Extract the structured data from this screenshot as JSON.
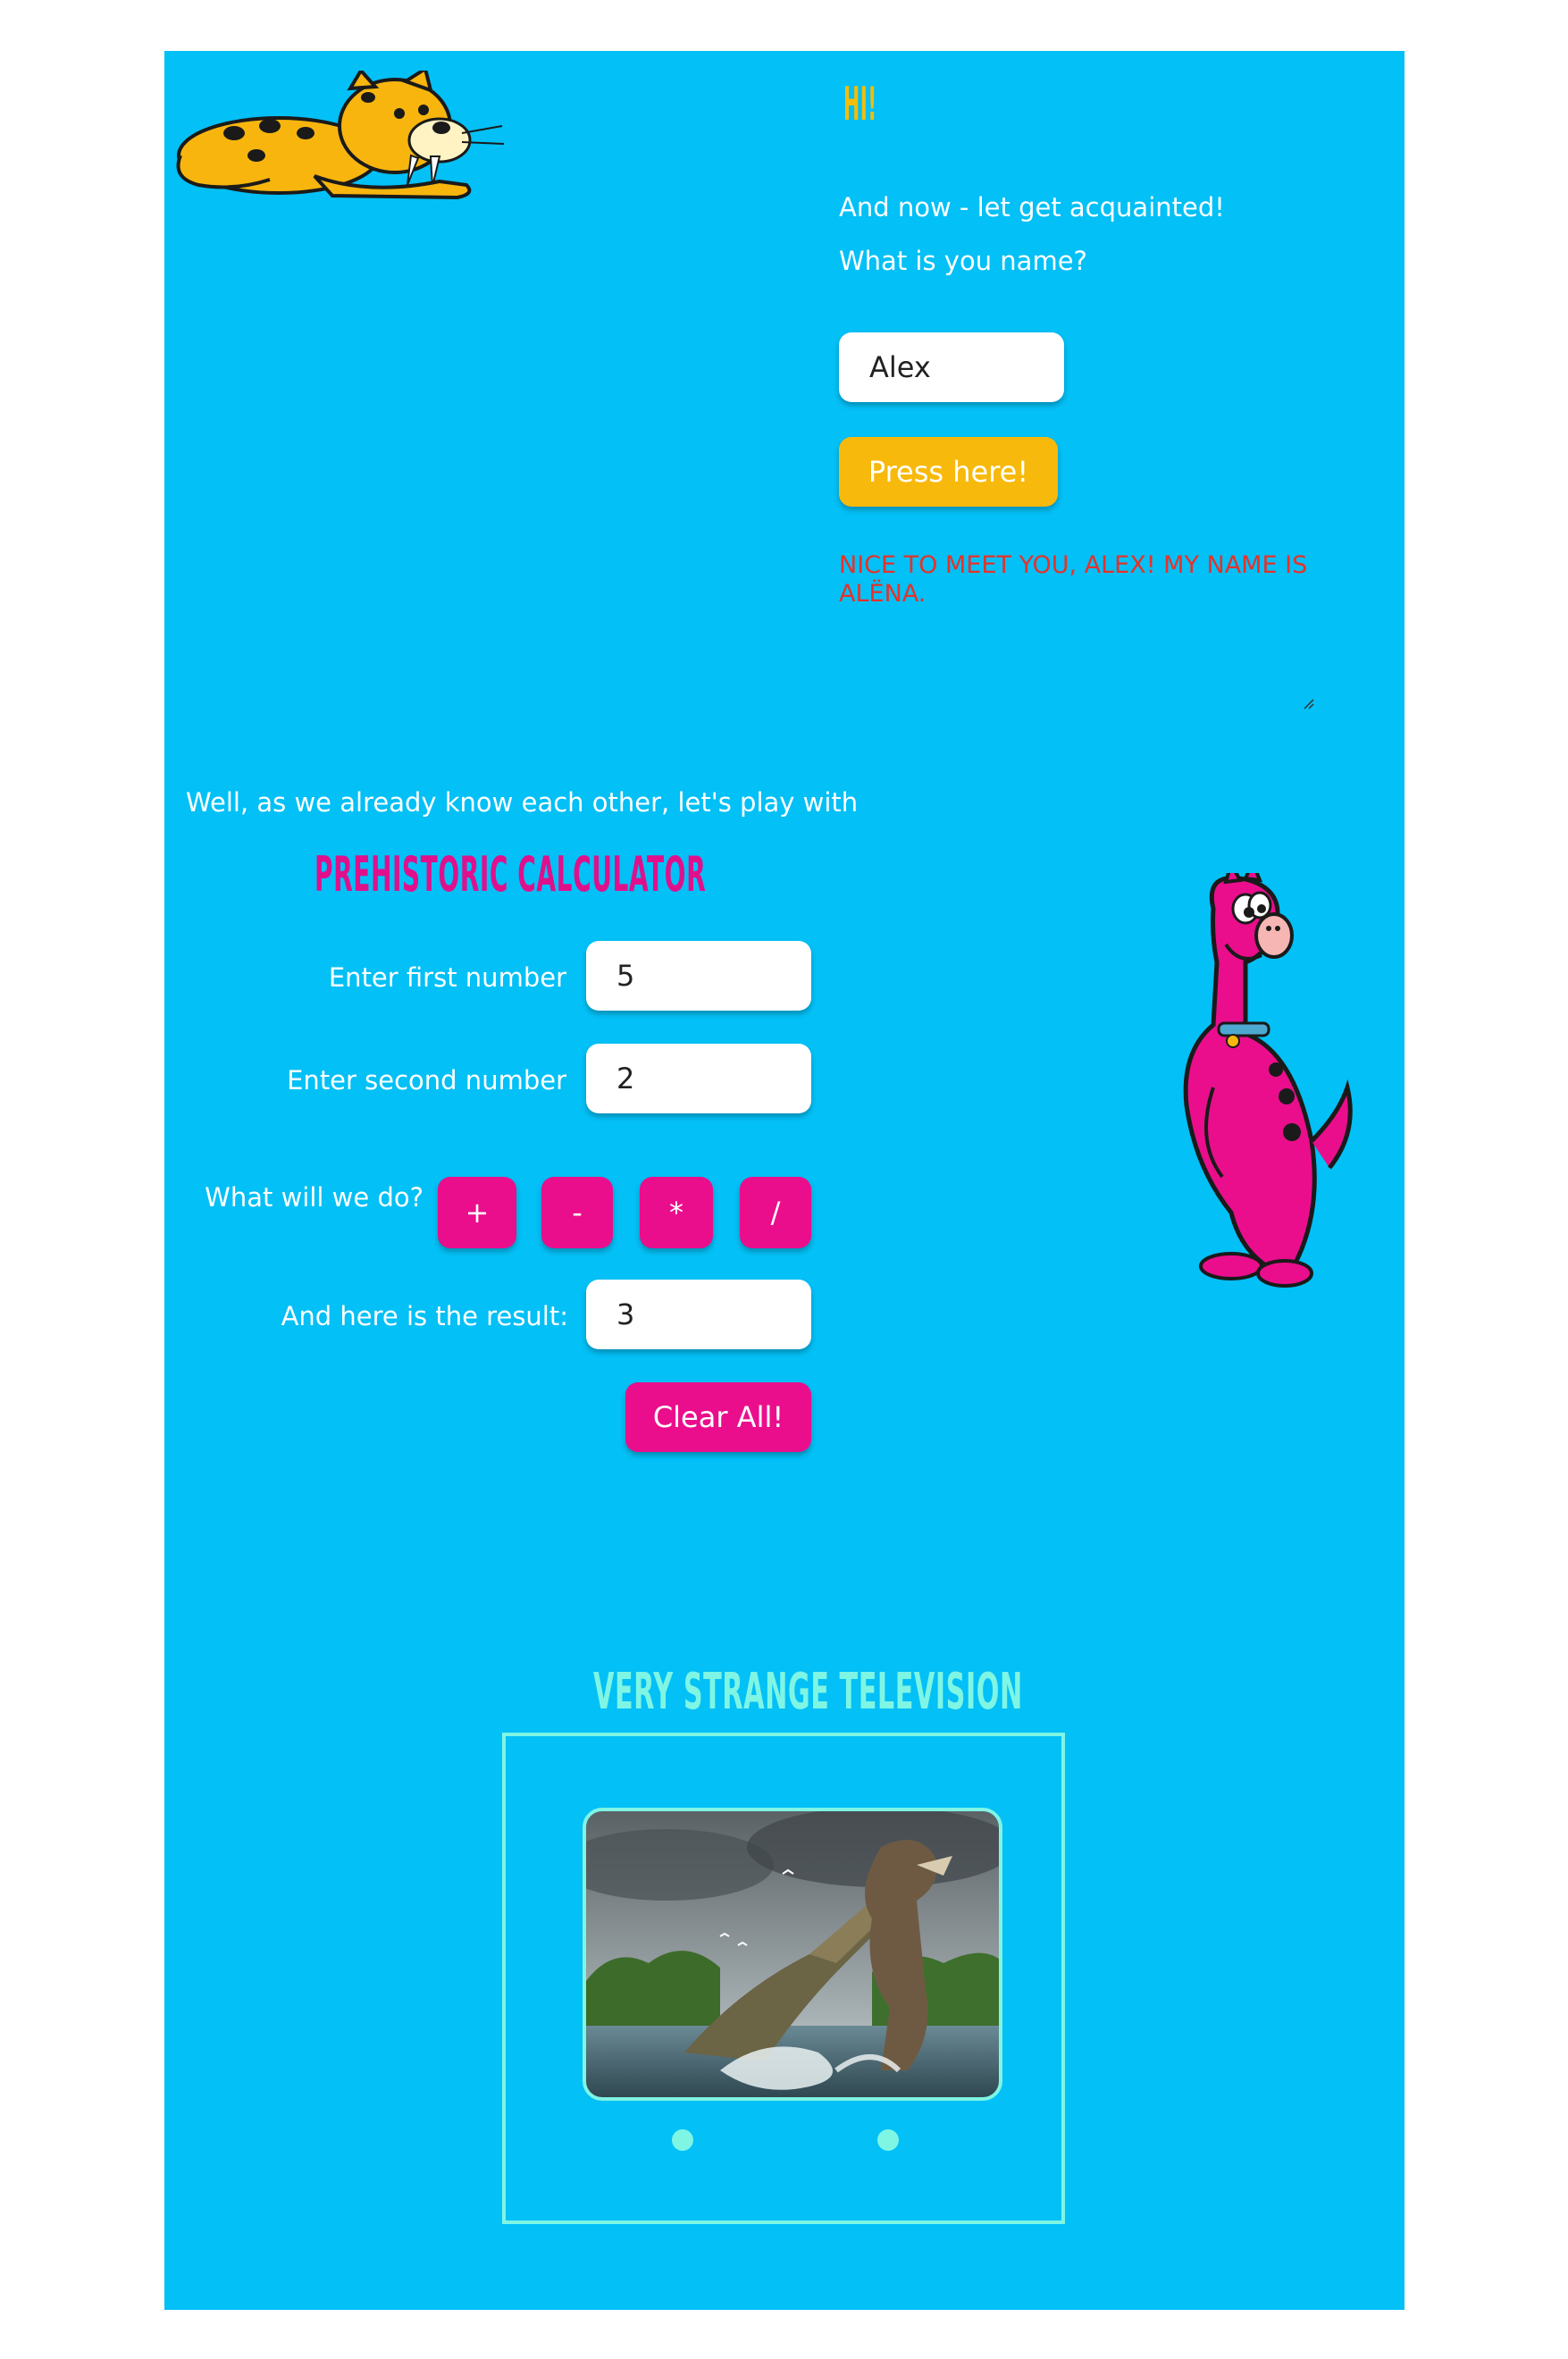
{
  "greeting": {
    "title": "HI!",
    "intro": "And now - let get acquainted!",
    "question": "What is you name?",
    "name_value": "Alex",
    "button_label": "Press here!",
    "reply": "NICE TO MEET YOU, ALEX! MY NAME IS ALËNA."
  },
  "calculator": {
    "intro": "Well, as we already know each other, let's play with",
    "title": "PREHISTORIC CALCULATOR",
    "first_label": "Enter first number",
    "first_value": "5",
    "second_label": "Enter second number",
    "second_value": "2",
    "operation_label": "What will we do?",
    "ops": [
      "+",
      "-",
      "*",
      "/"
    ],
    "result_label": "And here is the result:",
    "result_value": "3",
    "clear_label": "Clear All!"
  },
  "television": {
    "title": "VERY STRANGE TELEVISION"
  },
  "colors": {
    "background": "#03c0f6",
    "accent_yellow": "#f7b90b",
    "accent_pink": "#ea0e8c",
    "accent_aqua": "#7ff5e4",
    "reply_red": "#e5322a"
  },
  "icons": [
    "sabertooth-cat-icon",
    "pink-dinosaur-icon",
    "tv-knob-icon"
  ]
}
